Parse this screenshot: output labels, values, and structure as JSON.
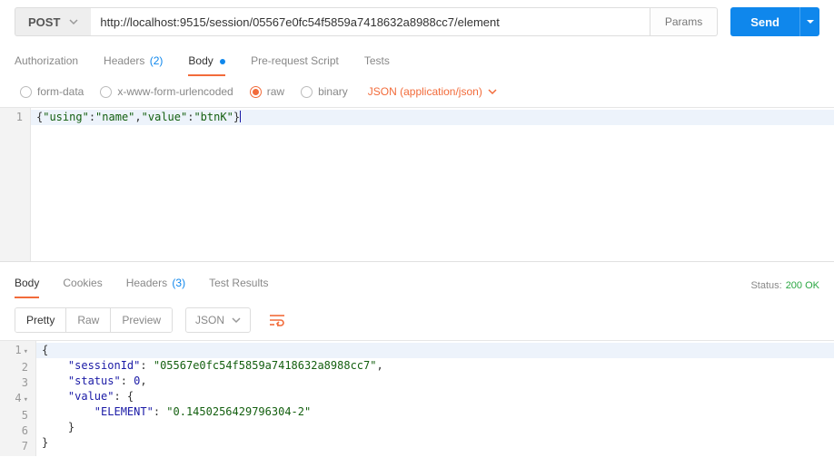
{
  "request": {
    "method": "POST",
    "url": "http://localhost:9515/session/05567e0fc54f5859a7418632a8988cc7/element",
    "paramsLabel": "Params",
    "sendLabel": "Send",
    "tabs": {
      "authorization": "Authorization",
      "headers": "Headers",
      "headersCount": "(2)",
      "body": "Body",
      "prerequest": "Pre-request Script",
      "tests": "Tests"
    },
    "bodyTypes": {
      "formdata": "form-data",
      "urlencoded": "x-www-form-urlencoded",
      "raw": "raw",
      "binary": "binary",
      "contentType": "JSON (application/json)"
    },
    "bodyEditor": {
      "line1": {
        "open": "{",
        "k1": "\"using\"",
        "c1": ":",
        "v1": "\"name\"",
        "sep": ",",
        "k2": "\"value\"",
        "c2": ":",
        "v2": "\"btnK\"",
        "close": "}"
      }
    }
  },
  "response": {
    "tabs": {
      "body": "Body",
      "cookies": "Cookies",
      "headers": "Headers",
      "headersCount": "(3)",
      "tests": "Test Results"
    },
    "statusLabel": "Status:",
    "statusValue": "200 OK",
    "viewModes": {
      "pretty": "Pretty",
      "raw": "Raw",
      "preview": "Preview"
    },
    "lang": "JSON",
    "body": {
      "l1": "{",
      "l2_indent": "    ",
      "l2_key": "\"sessionId\"",
      "l2_colon": ": ",
      "l2_val": "\"05567e0fc54f5859a7418632a8988cc7\"",
      "l2_comma": ",",
      "l3_indent": "    ",
      "l3_key": "\"status\"",
      "l3_colon": ": ",
      "l3_val": "0",
      "l3_comma": ",",
      "l4_indent": "    ",
      "l4_key": "\"value\"",
      "l4_colon": ": {",
      "l5_indent": "        ",
      "l5_key": "\"ELEMENT\"",
      "l5_colon": ": ",
      "l5_val": "\"0.1450256429796304-2\"",
      "l6": "    }",
      "l7": "}"
    }
  }
}
